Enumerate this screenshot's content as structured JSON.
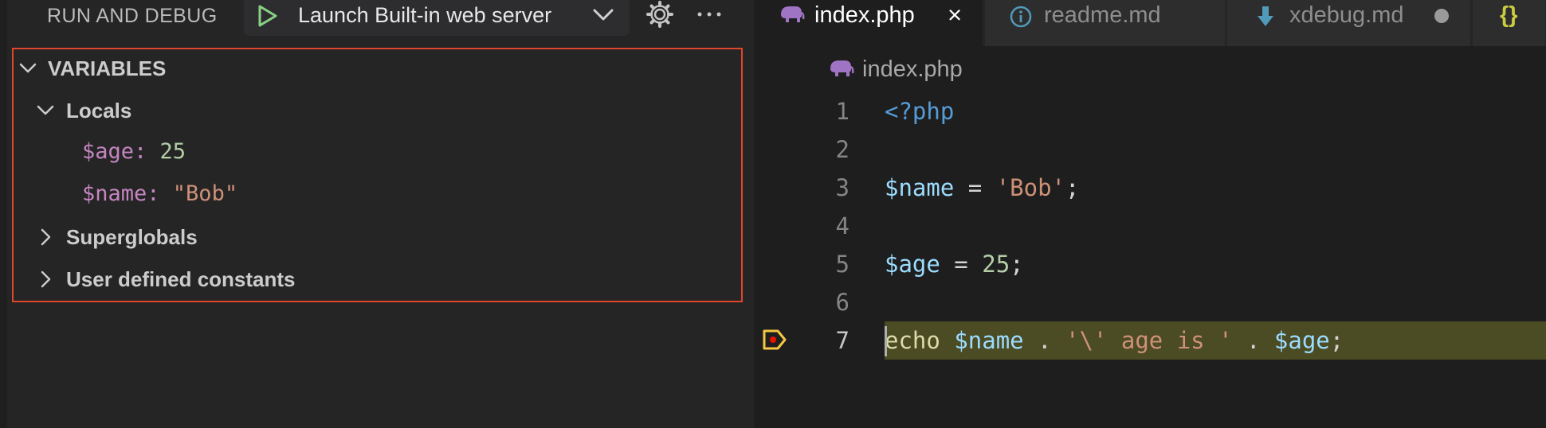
{
  "debug": {
    "title": "RUN AND DEBUG",
    "launch_config": "Launch Built-in web server",
    "icons": {
      "play": "play-icon",
      "chevron": "chevron-down-icon",
      "gear": "gear-icon",
      "more": "ellipsis-icon"
    }
  },
  "variables": {
    "header": "VARIABLES",
    "locals_label": "Locals",
    "locals": [
      {
        "name": "$age",
        "value": "25",
        "kind": "number"
      },
      {
        "name": "$name",
        "value": "\"Bob\"",
        "kind": "string"
      }
    ],
    "superglobals_label": "Superglobals",
    "constants_label": "User defined constants"
  },
  "editor": {
    "tabs": [
      {
        "label": "index.php",
        "icon": "php-elephant-icon",
        "active": true,
        "close": "×"
      },
      {
        "label": "readme.md",
        "icon": "info-icon",
        "active": false
      },
      {
        "label": "xdebug.md",
        "icon": "arrow-down-icon",
        "active": false,
        "modified": true
      },
      {
        "label": "{}",
        "icon": "json-icon",
        "active": false
      }
    ],
    "breadcrumb": "index.php",
    "lines": [
      {
        "n": "1",
        "tokens": [
          [
            "tk-tag",
            "<?php"
          ]
        ]
      },
      {
        "n": "2",
        "tokens": []
      },
      {
        "n": "3",
        "tokens": [
          [
            "tk-var",
            "$name"
          ],
          [
            "tk-op",
            " = "
          ],
          [
            "tk-str",
            "'Bob'"
          ],
          [
            "tk-op",
            ";"
          ]
        ]
      },
      {
        "n": "4",
        "tokens": []
      },
      {
        "n": "5",
        "tokens": [
          [
            "tk-var",
            "$age"
          ],
          [
            "tk-op",
            " = "
          ],
          [
            "tk-num",
            "25"
          ],
          [
            "tk-op",
            ";"
          ]
        ]
      },
      {
        "n": "6",
        "tokens": []
      },
      {
        "n": "7",
        "tokens": [
          [
            "tk-kw",
            "echo"
          ],
          [
            "tk-op",
            " "
          ],
          [
            "tk-var",
            "$name"
          ],
          [
            "tk-op",
            " . "
          ],
          [
            "tk-str",
            "'\\' age is '"
          ],
          [
            "tk-op",
            " . "
          ],
          [
            "tk-var",
            "$age"
          ],
          [
            "tk-op",
            ";"
          ]
        ]
      }
    ],
    "current_line": "7"
  },
  "colors": {
    "highlight": "#4b4b24",
    "panel_outline": "#e0462b",
    "play": "#89d185",
    "breakpoint": "#f4c842"
  }
}
